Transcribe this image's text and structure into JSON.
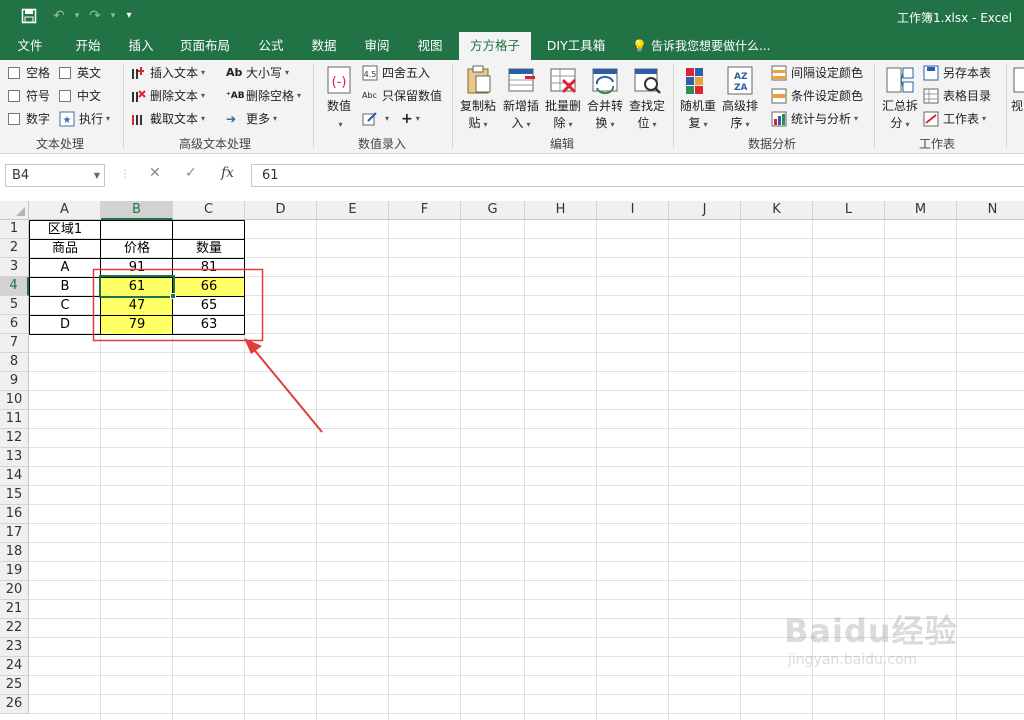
{
  "window": {
    "title": "工作簿1.xlsx - Excel",
    "quick_access": [
      "save-icon",
      "undo-icon",
      "redo-icon",
      "customize-icon"
    ]
  },
  "tabs": [
    "文件",
    "开始",
    "插入",
    "页面布局",
    "公式",
    "数据",
    "审阅",
    "视图",
    "方方格子",
    "DIY工具箱"
  ],
  "active_tab": "方方格子",
  "tell_me": "告诉我您想要做什么...",
  "ribbon": {
    "text_processing": {
      "label": "文本处理",
      "checkboxes": [
        "空格",
        "英文",
        "符号",
        "中文",
        "数字"
      ],
      "execute": "执行"
    },
    "advanced_text": {
      "label": "高级文本处理",
      "insert_text": "插入文本",
      "delete_text": "删除文本",
      "extract_text": "截取文本",
      "case": "大小写",
      "delete_space": "删除空格",
      "more": "更多"
    },
    "data_entry": {
      "label": "数值录入",
      "value": "数值",
      "round": "四舍五入",
      "keep_value": "只保留数值"
    },
    "edit": {
      "label": "编辑",
      "buttons": [
        {
          "line1": "复制粘",
          "line2": "贴"
        },
        {
          "line1": "新增插",
          "line2": "入"
        },
        {
          "line1": "批量删",
          "line2": "除"
        },
        {
          "line1": "合并转",
          "line2": "换"
        },
        {
          "line1": "查找定",
          "line2": "位"
        }
      ]
    },
    "data_analysis": {
      "label": "数据分析",
      "random": {
        "line1": "随机重",
        "line2": "复"
      },
      "sort": {
        "line1": "高级排",
        "line2": "序"
      },
      "interval_color": "间隔设定颜色",
      "cond_color": "条件设定颜色",
      "stats": "统计与分析"
    },
    "worksheet": {
      "label": "工作表",
      "summary": {
        "line1": "汇总拆",
        "line2": "分"
      },
      "save_sheet": "另存本表",
      "toc": "表格目录",
      "sheet": "工作表",
      "cut_off": "视"
    }
  },
  "formula_bar": {
    "name_box": "B4",
    "cancel": "✕",
    "enter": "✓",
    "fx": "fx",
    "value": "61"
  },
  "sheet": {
    "columns": [
      "A",
      "B",
      "C",
      "D",
      "E",
      "F",
      "G",
      "H",
      "I",
      "J",
      "K",
      "L",
      "M",
      "N"
    ],
    "rows": [
      "1",
      "2",
      "3",
      "4",
      "5",
      "6",
      "7",
      "8",
      "9",
      "10",
      "11",
      "12",
      "13",
      "14",
      "15",
      "16",
      "17",
      "18",
      "19",
      "20",
      "21",
      "22",
      "23",
      "24",
      "25",
      "26"
    ],
    "selected_cell": "B4",
    "cells": {
      "A1": "区域1",
      "A2": "商品",
      "B2": "价格",
      "C2": "数量",
      "A3": "A",
      "B3": "91",
      "C3": "81",
      "A4": "B",
      "B4": "61",
      "C4": "66",
      "A5": "C",
      "B5": "47",
      "C5": "65",
      "A6": "D",
      "B6": "79",
      "C6": "63"
    },
    "highlight_color": "#ffff66",
    "annotation_color": "#e03c3c"
  },
  "watermark": {
    "logo": "Baidu经验",
    "url": "jingyan.baidu.com"
  }
}
